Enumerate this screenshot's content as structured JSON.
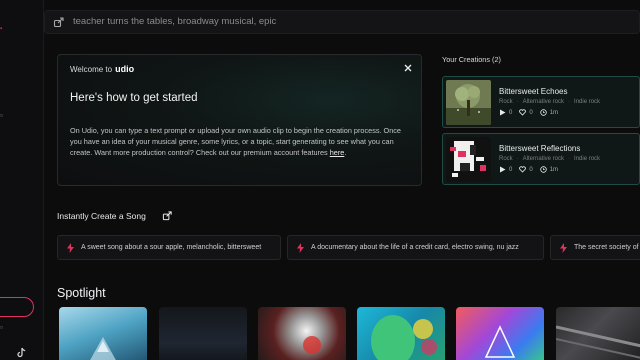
{
  "search": {
    "placeholder": "teacher turns the tables, broadway musical, epic"
  },
  "welcome": {
    "prefix": "Welcome to",
    "brand": "udio",
    "title": "Here's how to get started",
    "body": "On Udio, you can type a text prompt or upload your own audio clip to begin the creation process. Once you have an idea of your musical genre, some lyrics, or a topic, start generating to see what you can create. Want more production control? Check out our premium account features ",
    "link": "here",
    "end": "."
  },
  "creations": {
    "title": "Your Creations (2)",
    "items": [
      {
        "title": "Bittersweet Echoes",
        "tags": [
          "Rock",
          "Alternative rock",
          "Indie rock"
        ],
        "plays": "0",
        "likes": "0",
        "age": "1m"
      },
      {
        "title": "Bittersweet Reflections",
        "tags": [
          "Rock",
          "Alternative rock",
          "Indie rock"
        ],
        "plays": "0",
        "likes": "0",
        "age": "1m"
      }
    ]
  },
  "instant": {
    "title": "Instantly Create a Song",
    "chips": [
      "A sweet song about a sour apple, melancholic, bittersweet",
      "A documentary about the life of a credit card, electro swing, nu jazz",
      "The secret society of"
    ]
  },
  "spotlight": {
    "title": "Spotlight"
  },
  "colors": {
    "accent": "#e0315f",
    "card_border": "#1f4d45",
    "background": "#0c0c0d"
  }
}
